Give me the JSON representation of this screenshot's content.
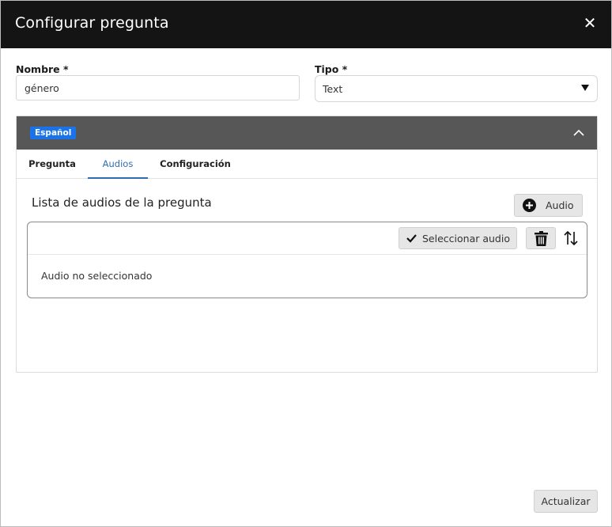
{
  "dialog": {
    "title": "Configurar pregunta",
    "close_icon": "close-icon"
  },
  "form": {
    "name_label": "Nombre *",
    "name_value": "género",
    "type_label": "Tipo *",
    "type_value": "Text"
  },
  "panel": {
    "language_badge": "Español",
    "collapse_icon": "chevron-up-icon",
    "tabs": [
      {
        "label": "Pregunta",
        "active": false
      },
      {
        "label": "Audios",
        "active": true
      },
      {
        "label": "Configuración",
        "active": false
      }
    ],
    "list_title": "Lista de audios de la pregunta",
    "add_audio_label": "Audio",
    "select_audio_label": "Seleccionar audio",
    "empty_message": "Audio no seleccionado"
  },
  "footer": {
    "update_label": "Actualizar"
  },
  "colors": {
    "header_bg": "#141414",
    "panel_head_bg": "#575757",
    "badge_bg": "#1a73e8",
    "active_tab": "#2f6db3"
  }
}
